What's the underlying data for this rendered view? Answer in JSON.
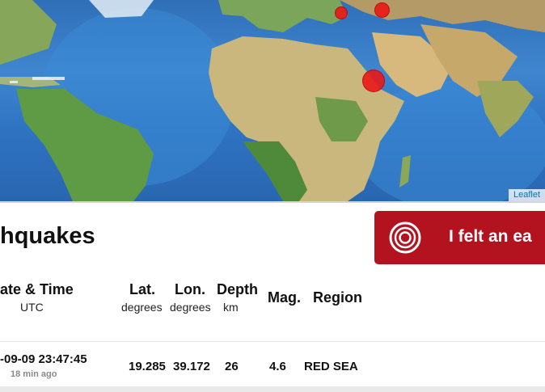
{
  "map": {
    "attribution": "Leaflet",
    "markers": [
      {
        "label": "event-1",
        "magnitude_hint": "small"
      },
      {
        "label": "event-2",
        "magnitude_hint": "small"
      },
      {
        "label": "event-3",
        "magnitude_hint": "large"
      }
    ]
  },
  "header": {
    "title": "hquakes"
  },
  "felt_button": {
    "label": "I felt an ea",
    "color": "#b3121f"
  },
  "table": {
    "columns": [
      {
        "label": "ate & Time",
        "unit": "UTC"
      },
      {
        "label": "Lat.",
        "unit": "degrees"
      },
      {
        "label": "Lon.",
        "unit": "degrees"
      },
      {
        "label": "Depth",
        "unit": "km"
      },
      {
        "label": "Mag.",
        "unit": ""
      },
      {
        "label": "Region",
        "unit": ""
      }
    ],
    "rows": [
      {
        "datetime": "-09-09 23:47:45",
        "ago": "18 min ago",
        "lat": "19.285",
        "lon": "39.172",
        "depth": "26",
        "mag": "4.6",
        "region": "RED SEA"
      }
    ]
  }
}
